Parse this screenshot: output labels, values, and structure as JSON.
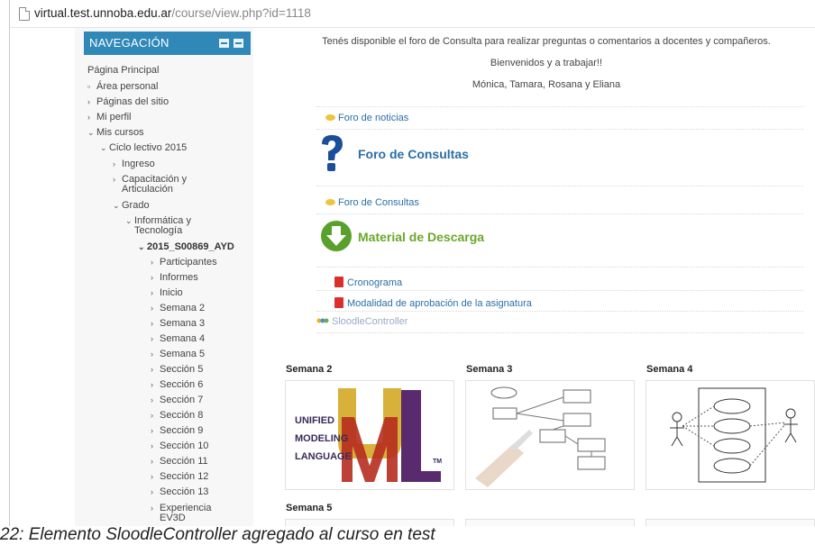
{
  "browser": {
    "url_host": "virtual.test.unnoba.edu.ar",
    "url_path": "/course/view.php?id=1118"
  },
  "sidebar": {
    "title": "NAVEGACIÓN",
    "items": [
      {
        "label": "Página Principal"
      },
      {
        "label": "Área personal"
      },
      {
        "label": "Páginas del sitio"
      },
      {
        "label": "Mi perfil"
      },
      {
        "label": "Mis cursos"
      },
      {
        "label": "Ciclo lectivo 2015"
      },
      {
        "label": "Ingreso"
      },
      {
        "label": "Capacitación y"
      },
      {
        "label": "Articulación"
      },
      {
        "label": "Grado"
      },
      {
        "label": "Informática y"
      },
      {
        "label": "Tecnología"
      },
      {
        "label": "2015_S00869_AYD"
      },
      {
        "label": "Participantes"
      },
      {
        "label": "Informes"
      },
      {
        "label": "Inicio"
      },
      {
        "label": "Semana 2"
      },
      {
        "label": "Semana 3"
      },
      {
        "label": "Semana 4"
      },
      {
        "label": "Semana 5"
      },
      {
        "label": "Sección 5"
      },
      {
        "label": "Sección 6"
      },
      {
        "label": "Sección 7"
      },
      {
        "label": "Sección 8"
      },
      {
        "label": "Sección 9"
      },
      {
        "label": "Sección 10"
      },
      {
        "label": "Sección 11"
      },
      {
        "label": "Sección 12"
      },
      {
        "label": "Sección 13"
      },
      {
        "label": "Experiencia"
      },
      {
        "label": "EV3D"
      }
    ]
  },
  "main": {
    "intro": "Tenés disponible el foro de Consulta para realizar preguntas o comentarios a docentes y compañeros.",
    "welcome": "Bienvenidos y a trabajar!!",
    "signature": "Mónica, Tamara, Rosana y Eliana",
    "foro_noticias": "Foro de noticias",
    "foro_consultas_title": "Foro de Consultas",
    "foro_consultas_link": "Foro de Consultas",
    "material_title": "Material de Descarga",
    "cronograma": "Cronograma",
    "modalidad": "Modalidad de aprobación de la asignatura",
    "sloodle": "SloodleController",
    "weeks": [
      {
        "label": "Semana 2"
      },
      {
        "label": "Semana 3"
      },
      {
        "label": "Semana 4"
      },
      {
        "label": "Semana 5"
      }
    ],
    "uml": {
      "l1": "UNIFIED",
      "l2": "MODELING",
      "l3": "LANGUAGE",
      "tm": "TM"
    }
  },
  "caption": "22: Elemento SloodleController agregado al curso en test",
  "colors": {
    "nav_header": "#2f88b8",
    "link": "#2a6fa8",
    "forum_title": "#2a6fa8",
    "material_title": "#6aa82b"
  }
}
